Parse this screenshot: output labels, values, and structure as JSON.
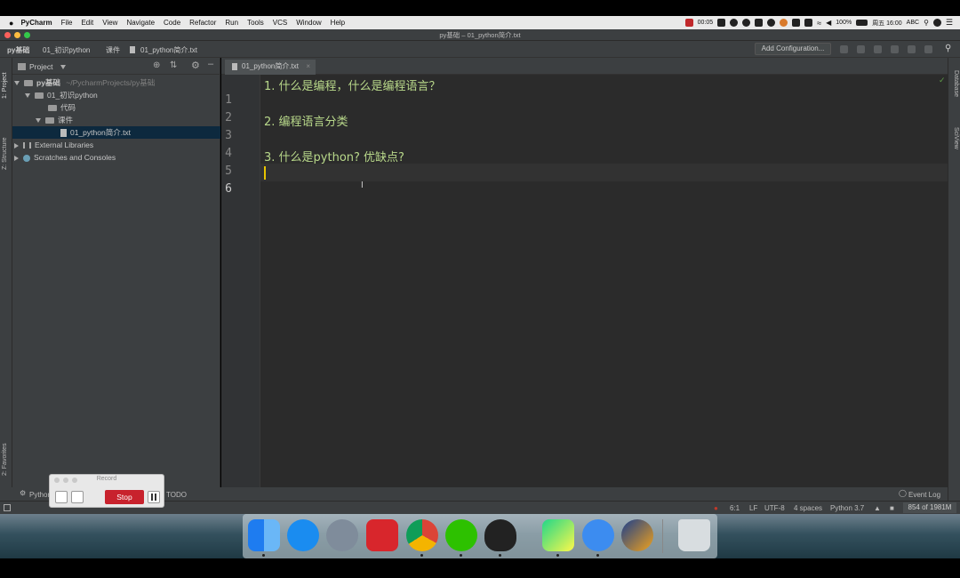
{
  "menubar": {
    "apple": "",
    "app_name": "PyCharm",
    "menus": [
      "File",
      "Edit",
      "View",
      "Navigate",
      "Code",
      "Refactor",
      "Run",
      "Tools",
      "VCS",
      "Window",
      "Help"
    ],
    "rec_time": "00:05",
    "battery": "100%",
    "datetime": "周五 16:00",
    "input_method": "ABC"
  },
  "window": {
    "title": "py基础 – 01_python简介.txt"
  },
  "navbar": {
    "breadcrumbs": [
      "py基础",
      "01_初识python",
      "课件",
      "01_python简介.txt"
    ],
    "add_configuration": "Add Configuration..."
  },
  "side_tabs": {
    "project": "1: Project",
    "structure": "Z: Structure",
    "favorites": "2: Favorites",
    "database": "Database",
    "sciview": "SciView"
  },
  "project_panel": {
    "header": "Project",
    "tree": {
      "root_name": "py基础",
      "root_path": "~/PycharmProjects/py基础",
      "folder1": "01_初识python",
      "sub1": "代码",
      "sub2": "课件",
      "file": "01_python简介.txt",
      "ext_libs": "External Libraries",
      "scratches": "Scratches and Consoles"
    }
  },
  "editor": {
    "tab": "01_python简介.txt",
    "line_numbers": [
      "1",
      "2",
      "3",
      "4",
      "5",
      "6"
    ],
    "lines": [
      "1. 什么是编程，什么是编程语言？",
      "",
      "2. 编程语言分类",
      "",
      "3. 什么是python?  优缺点?",
      ""
    ]
  },
  "bottom_tools": {
    "python_console": "Python",
    "todo": "TODO",
    "event_log": "Event Log"
  },
  "statusbar": {
    "position": "6:1",
    "line_sep": "LF",
    "encoding": "UTF-8",
    "indent": "4 spaces",
    "interpreter": "Python 3.7",
    "memory": "854 of 1981M"
  },
  "record_widget": {
    "title": "Record",
    "stop": "Stop"
  },
  "dock": {
    "apps": [
      "finder-icon",
      "safari-icon",
      "launchpad-icon",
      "netease-music-icon",
      "chrome-icon",
      "wechat-icon",
      "qq-icon",
      "pycharm-icon",
      "feishu-icon",
      "transmit-icon",
      "trash-icon"
    ]
  },
  "colors": {
    "editor_bg": "#2b2b2b",
    "panel_bg": "#3c3f41",
    "code_text": "#b8d88a",
    "caret": "#e8c400",
    "stop_red": "#c8222d"
  }
}
